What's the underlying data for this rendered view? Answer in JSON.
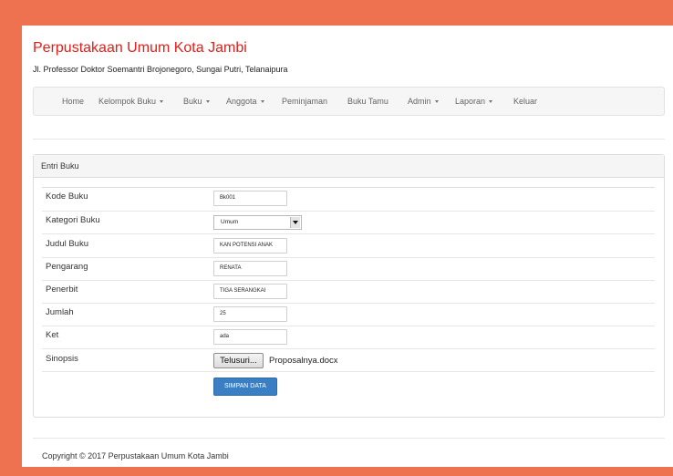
{
  "site": {
    "title": "Perpustakaan Umum Kota Jambi",
    "address": "Jl. Professor Doktor Soemantri Brojonegoro, Sungai Putri, Telanaipura"
  },
  "nav": {
    "items": [
      {
        "label": "Home",
        "dropdown": false
      },
      {
        "label": "Kelompok Buku",
        "dropdown": true
      },
      {
        "label": "Buku",
        "dropdown": true
      },
      {
        "label": "Anggota",
        "dropdown": true
      },
      {
        "label": "Peminjaman",
        "dropdown": false
      },
      {
        "label": "Buku Tamu",
        "dropdown": false
      },
      {
        "label": "Admin",
        "dropdown": true
      },
      {
        "label": "Laporan",
        "dropdown": true
      },
      {
        "label": "Keluar",
        "dropdown": false
      }
    ]
  },
  "panel": {
    "title": "Entri Buku"
  },
  "form": {
    "kode_buku": {
      "label": "Kode Buku",
      "value": "Bk001"
    },
    "kategori_buku": {
      "label": "Kategori Buku",
      "selected": "Umum"
    },
    "judul_buku": {
      "label": "Judul Buku",
      "value": "KAN POTENSI ANAK"
    },
    "pengarang": {
      "label": "Pengarang",
      "value": "RENATA"
    },
    "penerbit": {
      "label": "Penerbit",
      "value": "TIGA SERANGKAI"
    },
    "jumlah": {
      "label": "Jumlah",
      "value": "25"
    },
    "ket": {
      "label": "Ket",
      "value": "ada"
    },
    "sinopsis": {
      "label": "Sinopsis",
      "browse_label": "Telusuri...",
      "file_name": "Proposalnya.docx"
    },
    "submit_label": "SIMPAN DATA"
  },
  "footer": {
    "copyright": "Copyright © 2017 Perpustakaan Umum Kota Jambi"
  },
  "colors": {
    "frame": "#ee7250",
    "title": "#e0201b",
    "primary_button": "#3a7ec4"
  },
  "icons": {
    "nav_dropdown": "caret-down-icon",
    "select_arrow": "select-arrow-icon"
  }
}
